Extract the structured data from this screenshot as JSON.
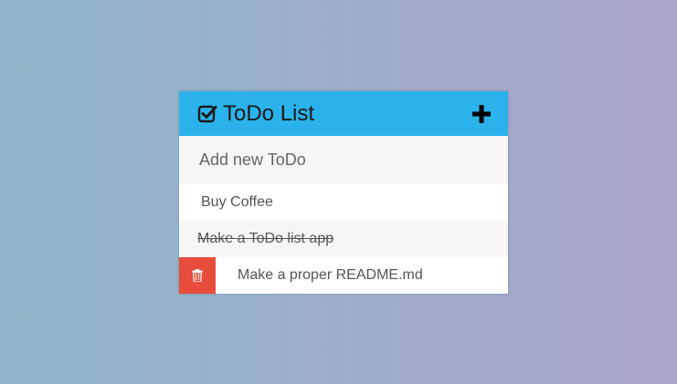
{
  "app": {
    "title": "ToDo List",
    "title_icon": "check-square-icon",
    "add_icon": "plus-icon"
  },
  "input": {
    "placeholder": "Add new ToDo",
    "value": ""
  },
  "todos": [
    {
      "text": "Buy Coffee",
      "completed": false
    },
    {
      "text": "Make a ToDo list app",
      "completed": true
    },
    {
      "text": "Make a proper README.md",
      "completed": false,
      "hovered": true
    }
  ],
  "colors": {
    "header": "#2cb2ea",
    "delete": "#e74c3c",
    "gradient_start": "#8fb6ca",
    "gradient_end": "#aaa4c9"
  }
}
